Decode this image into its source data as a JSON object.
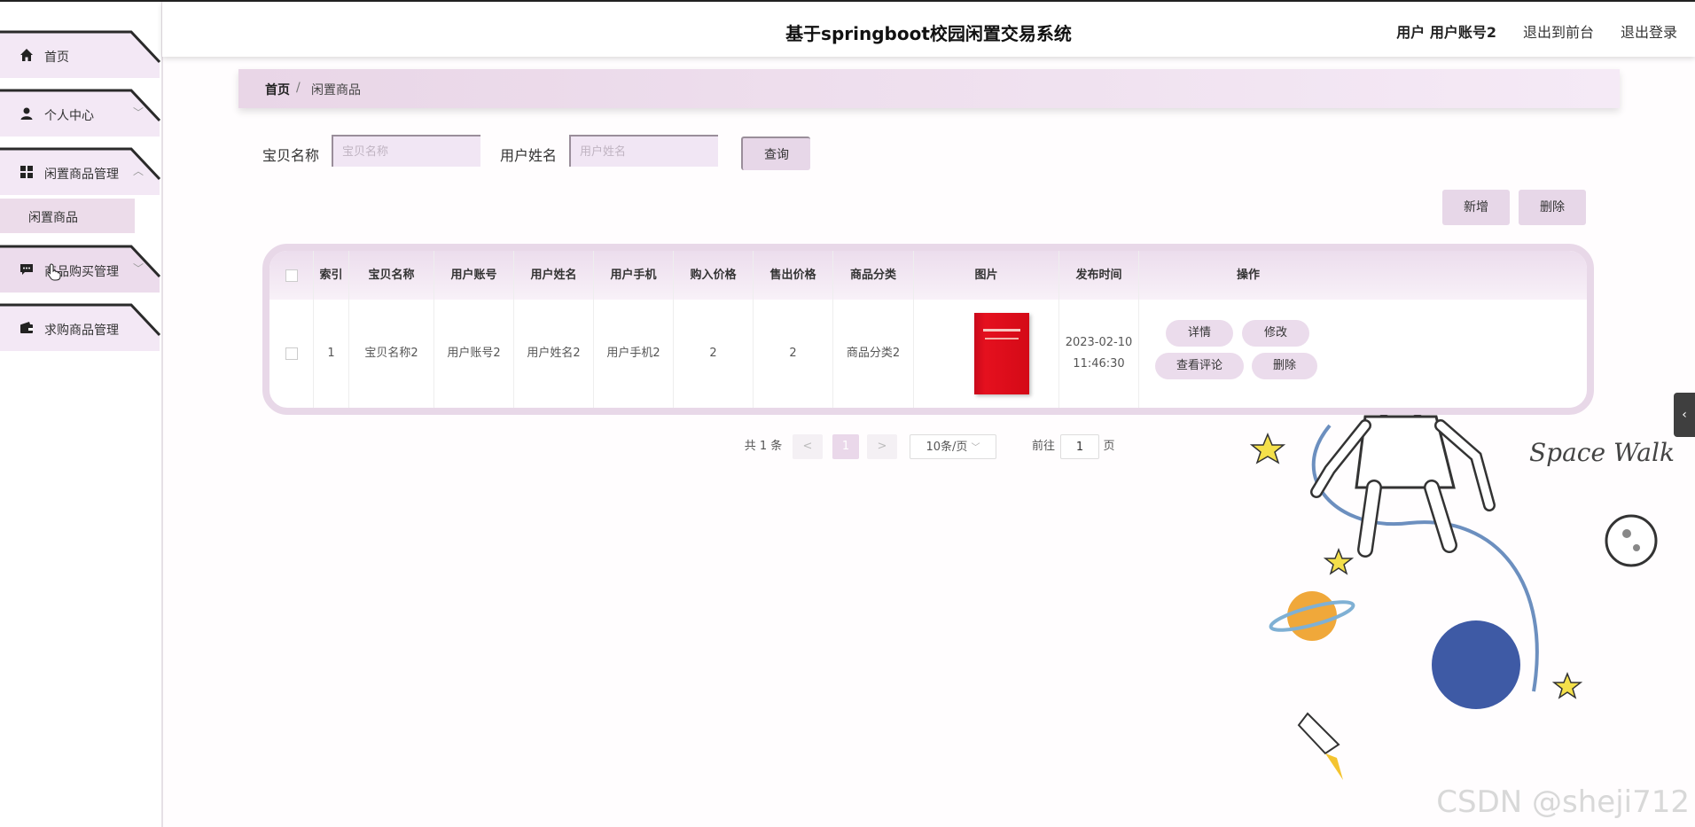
{
  "header": {
    "title": "基于springboot校园闲置交易系统",
    "user": "用户 用户账号2",
    "back_to_front": "退出到前台",
    "logout": "退出登录"
  },
  "sidebar": {
    "items": [
      {
        "label": "首页",
        "icon": "home-icon"
      },
      {
        "label": "个人中心",
        "icon": "user-icon"
      },
      {
        "label": "闲置商品管理",
        "icon": "grid-icon"
      },
      {
        "label": "商品购买管理",
        "icon": "chat-icon"
      },
      {
        "label": "求购商品管理",
        "icon": "wallet-icon"
      }
    ],
    "submenu": {
      "label": "闲置商品"
    }
  },
  "breadcrumb": {
    "home": "首页",
    "separator": "/",
    "current": "闲置商品"
  },
  "search": {
    "name_label": "宝贝名称",
    "name_placeholder": "宝贝名称",
    "user_label": "用户姓名",
    "user_placeholder": "用户姓名",
    "query_button": "查询"
  },
  "actions": {
    "add": "新增",
    "delete": "删除"
  },
  "table": {
    "columns": [
      "索引",
      "宝贝名称",
      "用户账号",
      "用户姓名",
      "用户手机",
      "购入价格",
      "售出价格",
      "商品分类",
      "图片",
      "发布时间",
      "操作"
    ],
    "rows": [
      {
        "index": "1",
        "name": "宝贝名称2",
        "account": "用户账号2",
        "username": "用户姓名2",
        "phone": "用户手机2",
        "buy_price": "2",
        "sell_price": "2",
        "category": "商品分类2",
        "date": "2023-02-10",
        "time": "11:46:30",
        "ops": {
          "detail": "详情",
          "edit": "修改",
          "comments": "查看评论",
          "delete": "删除"
        }
      }
    ]
  },
  "pagination": {
    "total": "共 1 条",
    "prev": "<",
    "current": "1",
    "next": ">",
    "page_size": "10条/页",
    "goto_label": "前往",
    "goto_value": "1",
    "page_unit": "页"
  },
  "decoration": {
    "text": "Space Walk"
  },
  "watermark": "CSDN @sheji712"
}
